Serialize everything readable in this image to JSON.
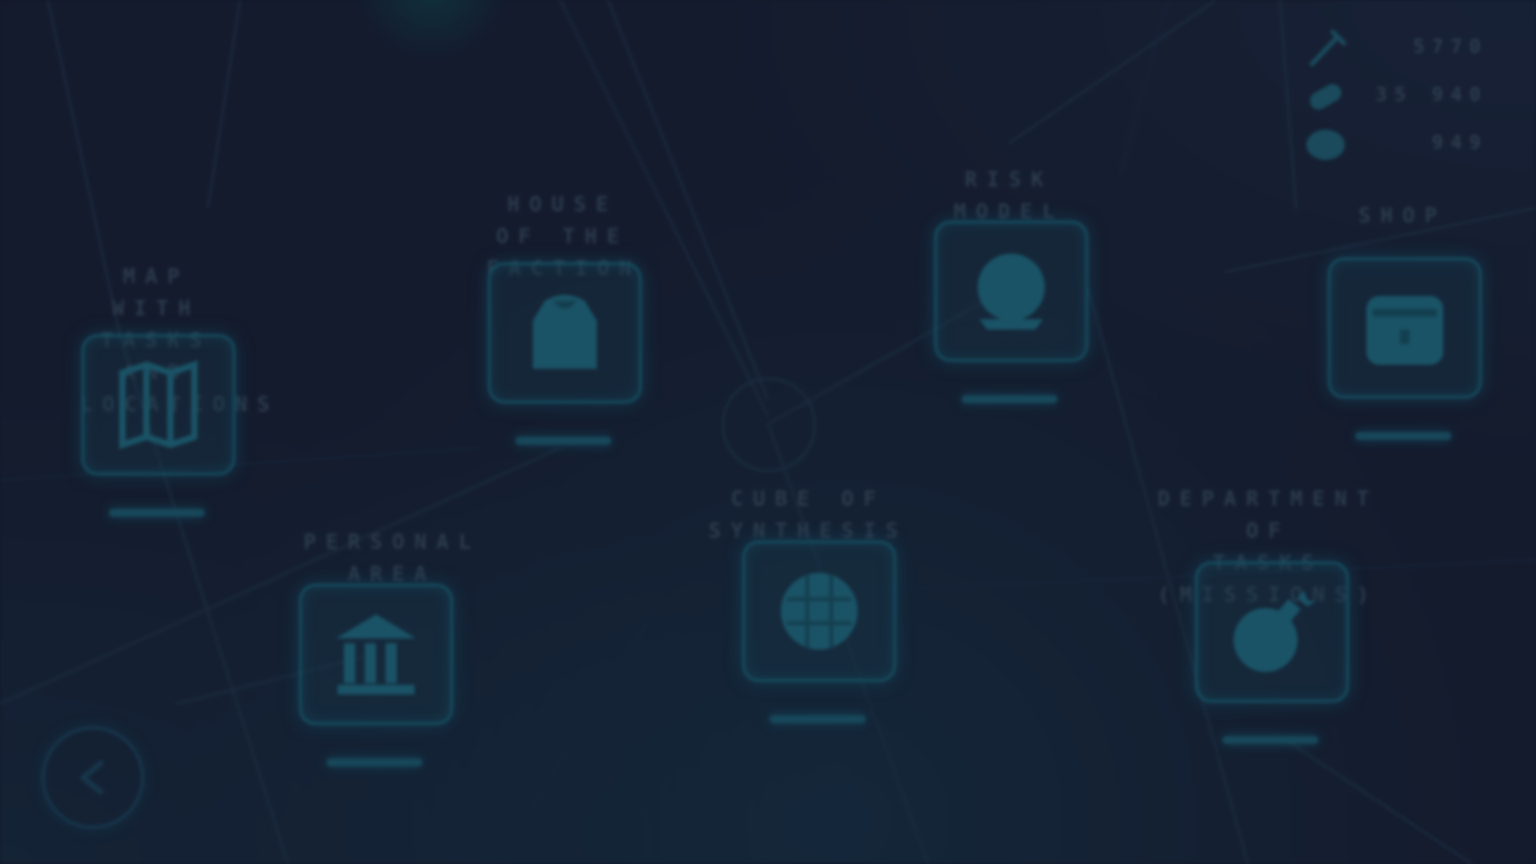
{
  "nodes": [
    {
      "id": "map",
      "title": "MAP WITH TASKS\nAND LOCATIONS",
      "icon": "map-icon"
    },
    {
      "id": "house",
      "title": "HOUSE OF THE\nFACTION",
      "icon": "hoodie-icon"
    },
    {
      "id": "risk",
      "title": "RISK MODEL",
      "icon": "planet-icon"
    },
    {
      "id": "shop",
      "title": "SHOP",
      "icon": "basket-icon"
    },
    {
      "id": "personal",
      "title": "PERSONAL AREA",
      "icon": "bank-icon"
    },
    {
      "id": "cube",
      "title": "CUBE OF SYNTHESIS",
      "icon": "cube-icon"
    },
    {
      "id": "dept",
      "title": "DEPARTMENT OF\nTASKS (MISSIONS)",
      "icon": "bomb-icon"
    }
  ],
  "resources": [
    {
      "icon": "syringe-icon",
      "value": "5770"
    },
    {
      "icon": "pill-icon",
      "value": "35 940"
    },
    {
      "icon": "brain-icon",
      "value": "949"
    }
  ],
  "back_button": {
    "icon": "back-arrow-icon"
  },
  "colors": {
    "background": "#141b2d",
    "frame": "#155062",
    "text_dim": "#2b3b4d"
  }
}
